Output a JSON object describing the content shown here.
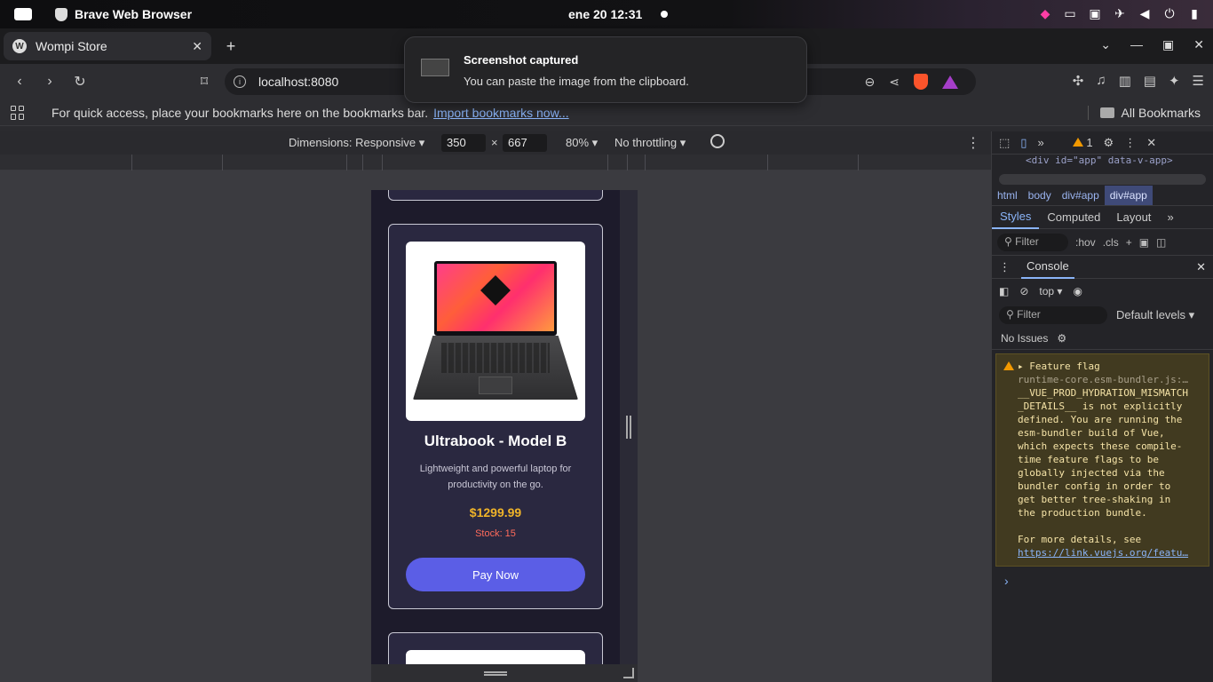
{
  "system_bar": {
    "app_name": "Brave Web Browser",
    "clock": "ene 20  12:31"
  },
  "browser": {
    "tab_title": "Wompi Store",
    "tab_favicon": "W",
    "url": "localhost:8080",
    "bookmarks_prompt": "For quick access, place your bookmarks here on the bookmarks bar.",
    "bookmarks_import_link": "Import bookmarks now...",
    "all_bookmarks": "All Bookmarks"
  },
  "notification": {
    "title": "Screenshot captured",
    "body": "You can paste the image from the clipboard."
  },
  "device_toolbar": {
    "dimensions_label": "Dimensions: Responsive",
    "width": "350",
    "height": "667",
    "zoom": "80%",
    "throttling": "No throttling"
  },
  "product": {
    "title": "Ultrabook - Model B",
    "description": "Lightweight and powerful laptop for productivity on the go.",
    "price": "$1299.99",
    "stock": "Stock: 15",
    "button": "Pay Now",
    "colors": {
      "price": "#f0b429",
      "stock": "#ff6b5b",
      "button": "#5b5ee6"
    }
  },
  "devtools": {
    "warning_count": "1",
    "element_snippet": "<div id=\"app\" data-v-app>",
    "breadcrumbs": [
      "html",
      "body",
      "div#app",
      "div#app"
    ],
    "subtabs": [
      "Styles",
      "Computed",
      "Layout"
    ],
    "styles_filter_placeholder": "Filter",
    "hov": ":hov",
    "cls": ".cls",
    "console_title": "Console",
    "context": "top",
    "console_filter_placeholder": "Filter",
    "levels": "Default levels",
    "issues": "No Issues",
    "warning": {
      "title": "Feature flag",
      "source": "runtime-core.esm-bundler.js:…",
      "lines": [
        "__VUE_PROD_HYDRATION_MISMATCH",
        "_DETAILS__ is not explicitly",
        "defined. You are running the",
        "esm-bundler build of Vue,",
        "which expects these compile-",
        "time feature flags to be",
        "globally injected via the",
        "bundler config in order to",
        "get better tree-shaking in",
        "the production bundle."
      ],
      "more": "For more details, see",
      "link": "https://link.vuejs.org/featu…",
      "tail": "."
    }
  }
}
